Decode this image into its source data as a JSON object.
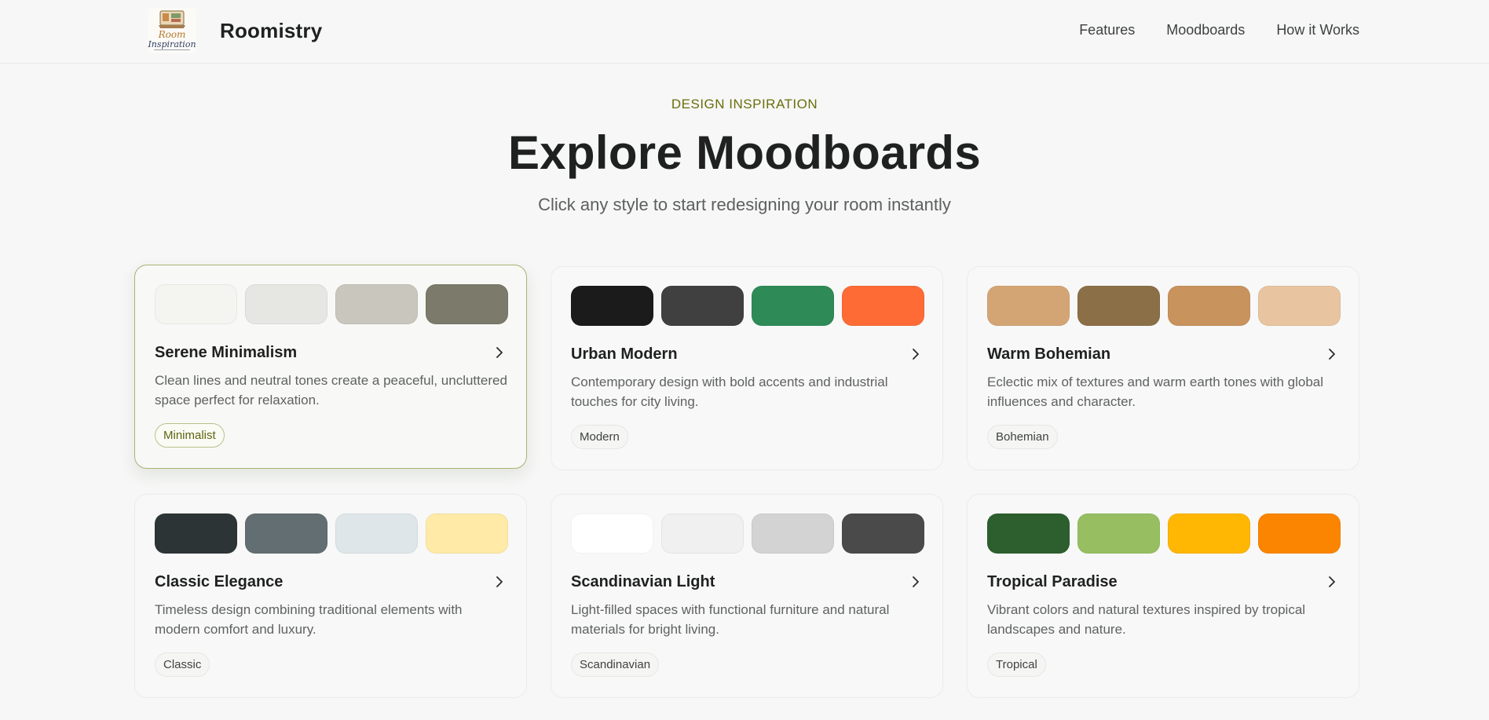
{
  "header": {
    "brand_name": "Roomistry",
    "logo_alt": "Room Inspiration",
    "nav": [
      {
        "label": "Features"
      },
      {
        "label": "Moodboards"
      },
      {
        "label": "How it Works"
      }
    ]
  },
  "hero": {
    "eyebrow": "DESIGN INSPIRATION",
    "title": "Explore Moodboards",
    "subtitle": "Click any style to start redesigning your room instantly"
  },
  "cards": [
    {
      "title": "Serene Minimalism",
      "description": "Clean lines and neutral tones create a peaceful, uncluttered space perfect for relaxation.",
      "tag": "Minimalist",
      "selected": true,
      "colors": [
        "#f4f5f1",
        "#e6e6e2",
        "#c9c6bd",
        "#7b7a6b"
      ]
    },
    {
      "title": "Urban Modern",
      "description": "Contemporary design with bold accents and industrial touches for city living.",
      "tag": "Modern",
      "selected": false,
      "colors": [
        "#1b1b1b",
        "#404040",
        "#2e8b57",
        "#ff6b35"
      ]
    },
    {
      "title": "Warm Bohemian",
      "description": "Eclectic mix of textures and warm earth tones with global influences and character.",
      "tag": "Bohemian",
      "selected": false,
      "colors": [
        "#d4a574",
        "#8b6f47",
        "#c9935e",
        "#e8c5a0"
      ]
    },
    {
      "title": "Classic Elegance",
      "description": "Timeless design combining traditional elements with modern comfort and luxury.",
      "tag": "Classic",
      "selected": false,
      "colors": [
        "#2d3436",
        "#636e72",
        "#dfe6e9",
        "#ffeaa7"
      ]
    },
    {
      "title": "Scandinavian Light",
      "description": "Light-filled spaces with functional furniture and natural materials for bright living.",
      "tag": "Scandinavian",
      "selected": false,
      "colors": [
        "#ffffff",
        "#f0f0f0",
        "#d3d3d3",
        "#4a4a4a"
      ]
    },
    {
      "title": "Tropical Paradise",
      "description": "Vibrant colors and natural textures inspired by tropical landscapes and nature.",
      "tag": "Tropical",
      "selected": false,
      "colors": [
        "#2d5f2e",
        "#97bf62",
        "#ffb703",
        "#fb8500"
      ]
    }
  ]
}
